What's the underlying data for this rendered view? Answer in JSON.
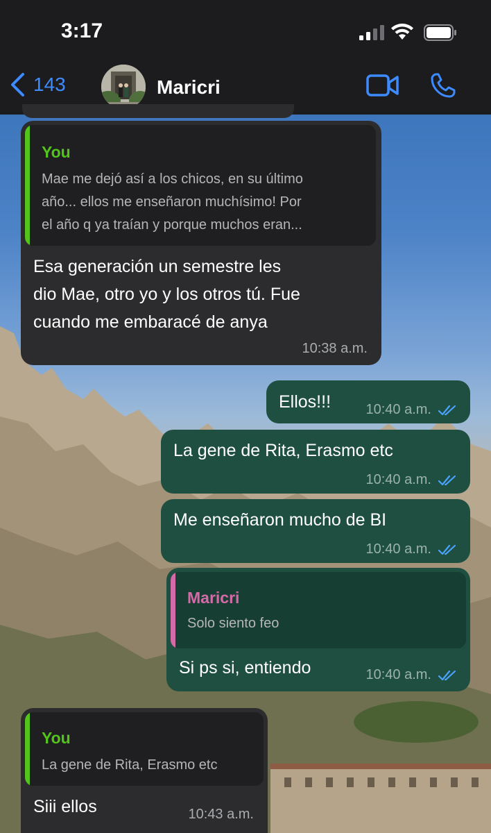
{
  "status_bar": {
    "time": "3:17"
  },
  "header": {
    "back_count": "143",
    "contact_name": "Maricri"
  },
  "colors": {
    "accent": "#3d8bff",
    "incoming_bubble": "#2c2c2e",
    "outgoing_bubble": "#1f4f41",
    "you_quote_color": "#52c41a",
    "maricri_quote_color": "#d66aa8",
    "read_ticks": "#4aa3ff"
  },
  "messages": [
    {
      "direction": "incoming",
      "quote": {
        "author": "You",
        "text_lines": [
          "Mae me dejó así a los chicos, en su último",
          "año... ellos me enseñaron muchísimo! Por",
          "el año q ya traían y porque muchos eran..."
        ]
      },
      "text_lines": [
        "Esa generación un semestre les",
        "dio Mae, otro yo y los otros tú. Fue",
        "cuando me embaracé de anya"
      ],
      "time": "10:38 a.m."
    },
    {
      "direction": "outgoing",
      "text": "Ellos!!!",
      "time": "10:40 a.m.",
      "status": "read"
    },
    {
      "direction": "outgoing",
      "text": "La gene de Rita, Erasmo etc",
      "time": "10:40 a.m.",
      "status": "read"
    },
    {
      "direction": "outgoing",
      "text": "Me enseñaron mucho de BI",
      "time": "10:40 a.m.",
      "status": "read"
    },
    {
      "direction": "outgoing",
      "quote": {
        "author": "Maricri",
        "text": "Solo siento feo"
      },
      "text": "Si ps si, entiendo",
      "time": "10:40 a.m.",
      "status": "read"
    },
    {
      "direction": "incoming",
      "quote": {
        "author": "You",
        "text": "La gene de Rita, Erasmo etc"
      },
      "text": "Siii ellos",
      "time": "10:43 a.m."
    }
  ]
}
